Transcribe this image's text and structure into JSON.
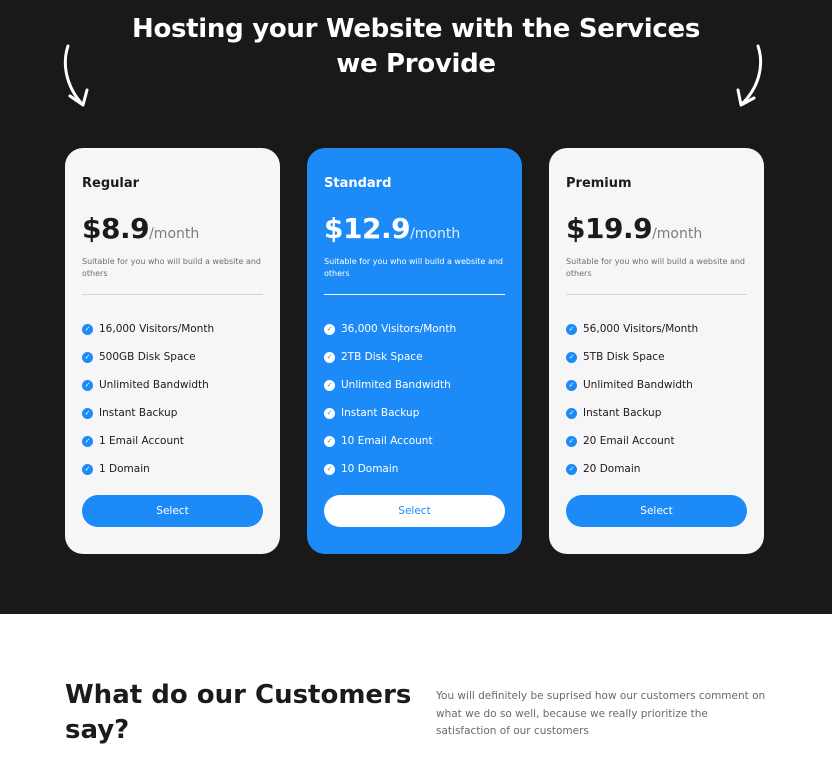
{
  "hero": {
    "title_line1": "Hosting your Website with the Services",
    "title_line2": "we Provide",
    "left_icon": "curved-arrow-down-icon",
    "right_icon": "curved-arrow-down-icon"
  },
  "colors": {
    "accent": "#1d8bf7",
    "hero_bg": "#1a1919",
    "card_bg": "#f6f6f6"
  },
  "plans": [
    {
      "name": "Regular",
      "price": "$8.9",
      "period": "/month",
      "description": "Suitable for you who will build a website and others",
      "features": [
        "16,000 Visitors/Month",
        "500GB Disk Space",
        "Unlimited Bandwidth",
        "Instant Backup",
        "1 Email Account",
        "1 Domain"
      ],
      "button": "Select"
    },
    {
      "name": "Standard",
      "price": "$12.9",
      "period": "/month",
      "description": "Suitable for you who will build a website and others",
      "features": [
        "36,000 Visitors/Month",
        "2TB Disk Space",
        "Unlimited Bandwidth",
        "Instant Backup",
        "10 Email Account",
        "10 Domain"
      ],
      "button": "Select"
    },
    {
      "name": "Premium",
      "price": "$19.9",
      "period": "/month",
      "description": "Suitable for you who will build a website and others",
      "features": [
        "56,000 Visitors/Month",
        "5TB Disk Space",
        "Unlimited Bandwidth",
        "Instant Backup",
        "20 Email Account",
        "20 Domain"
      ],
      "button": "Select"
    }
  ],
  "customers": {
    "title_line1": "What do our Customers",
    "title_line2": "say?",
    "text": "You will definitely be suprised how our customers comment on what we do so well, because we really prioritize the satisfaction of our customers"
  }
}
